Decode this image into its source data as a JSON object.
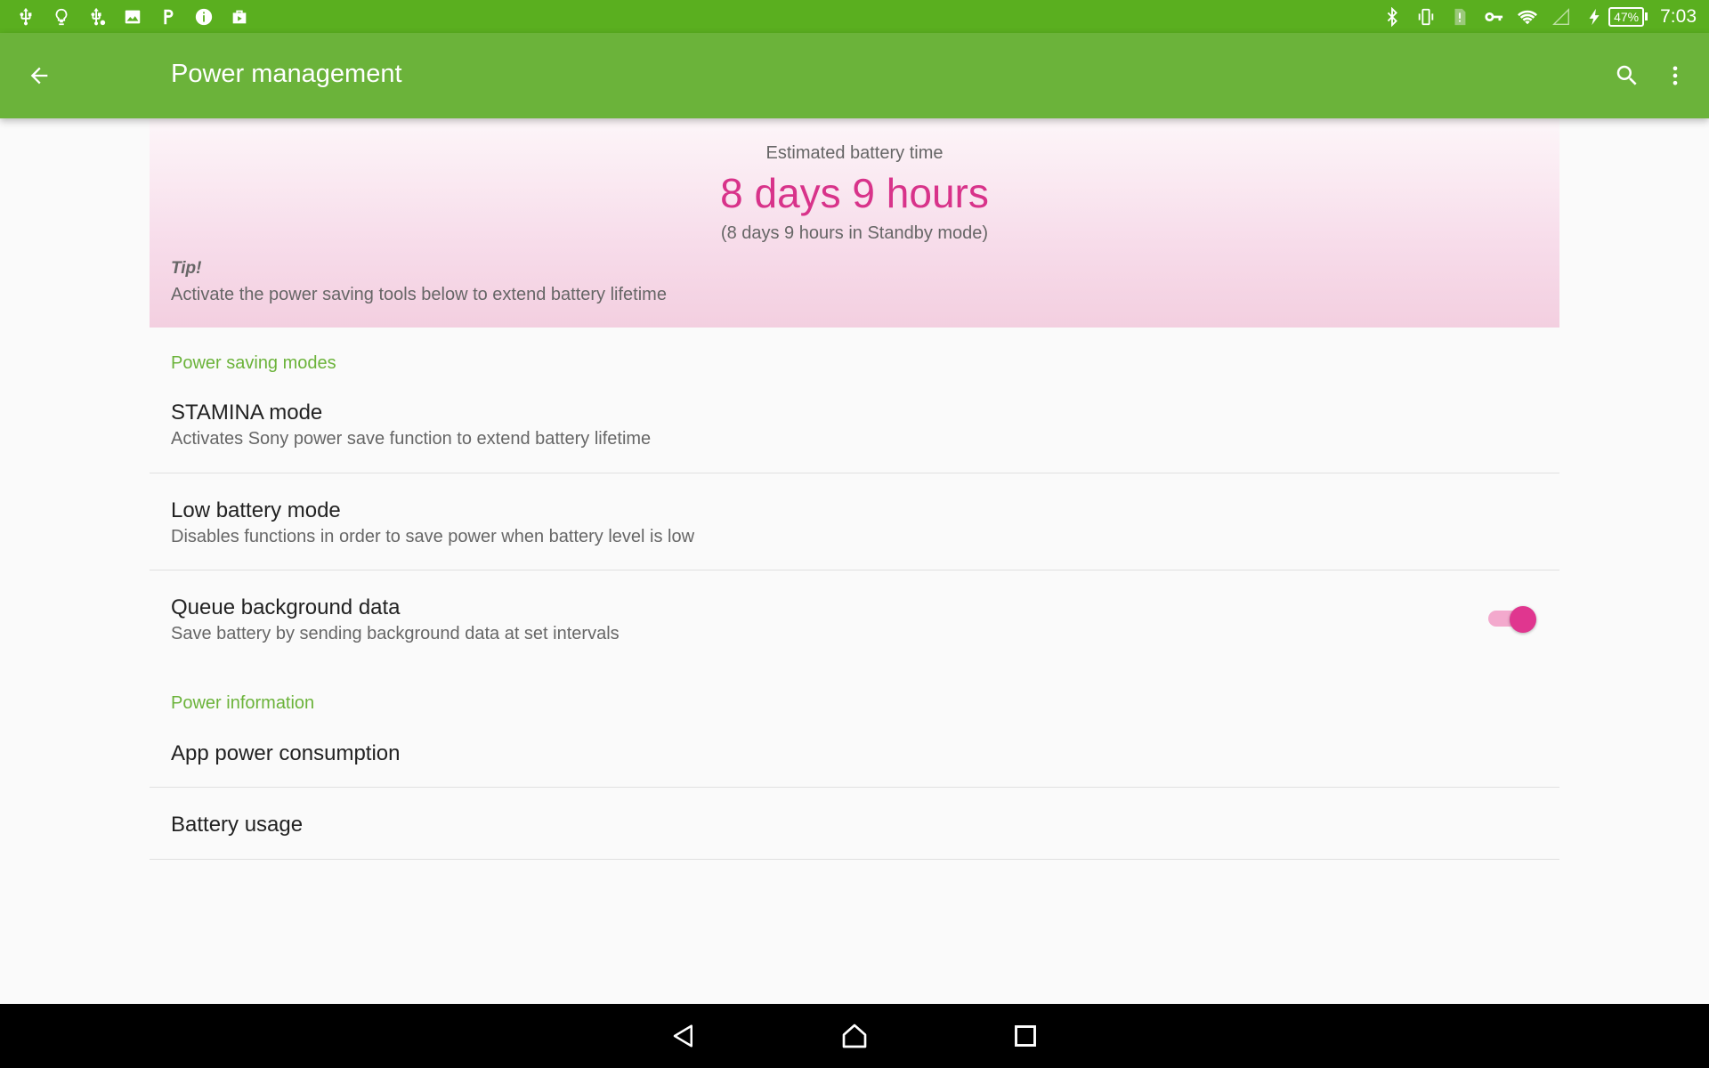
{
  "status_bar": {
    "left_icons": [
      "usb-icon",
      "lightbulb-icon",
      "usb-debug-icon",
      "gallery-icon",
      "p-app-icon",
      "info-icon",
      "store-icon"
    ],
    "right_icons": [
      "bluetooth-icon",
      "vibrate-icon",
      "sim-icon",
      "vpn-key-icon",
      "wifi-icon",
      "no-signal-icon",
      "charging-icon"
    ],
    "battery_percent": "47%",
    "time": "7:03"
  },
  "app_bar": {
    "title": "Power management",
    "icons": [
      "back-arrow-icon",
      "search-icon",
      "more-vert-icon"
    ],
    "color": "#6bb33a"
  },
  "battery": {
    "label": "Estimated battery time",
    "value": "8 days 9 hours",
    "sub": "(8 days 9 hours in Standby mode)",
    "tip_title": "Tip!",
    "tip_text": "Activate the power saving tools below to extend battery lifetime",
    "accent_color": "#d8338a"
  },
  "sections": {
    "power_saving": {
      "header": "Power saving modes",
      "items": [
        {
          "title": "STAMINA mode",
          "subtitle": "Activates Sony power save function to extend battery lifetime"
        },
        {
          "title": "Low battery mode",
          "subtitle": "Disables functions in order to save power when battery level is low"
        },
        {
          "title": "Queue background data",
          "subtitle": "Save battery by sending background data at set intervals",
          "toggle_on": true
        }
      ]
    },
    "power_info": {
      "header": "Power information",
      "items": [
        {
          "title": "App power consumption"
        },
        {
          "title": "Battery usage"
        }
      ]
    }
  },
  "nav_bar": {
    "icons": [
      "nav-back-icon",
      "nav-home-icon",
      "nav-recents-icon"
    ]
  }
}
